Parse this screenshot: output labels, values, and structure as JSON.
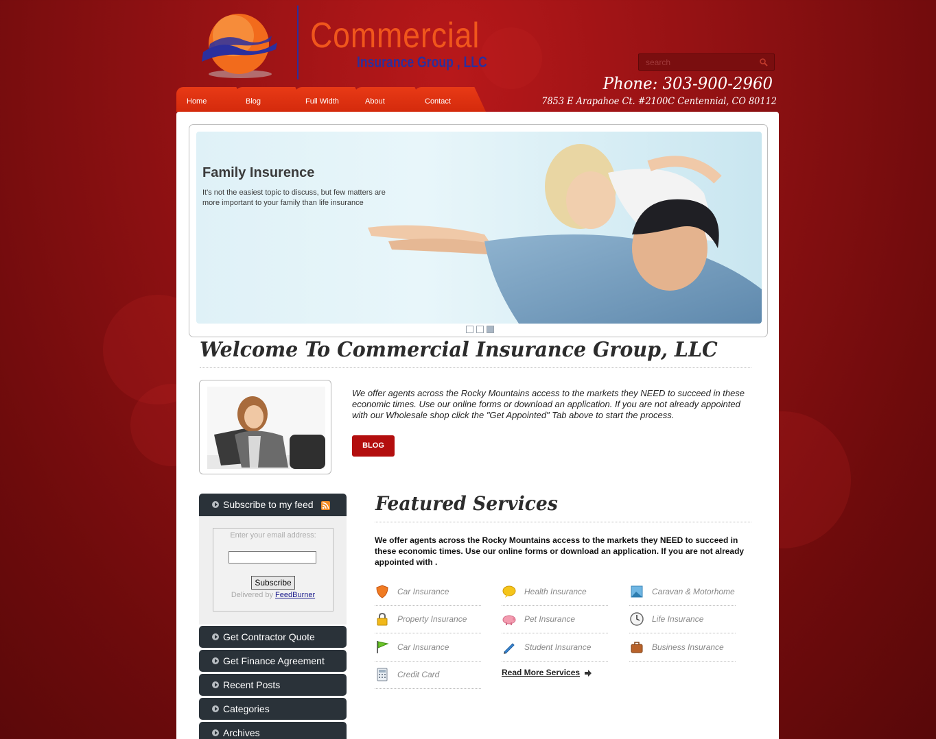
{
  "logo": {
    "title": "Commercial",
    "subtitle": "Insurance Group , LLC"
  },
  "search": {
    "placeholder": "search"
  },
  "contact": {
    "phone": "Phone: 303-900-2960",
    "address": "7853 E Arapahoe Ct. #2100C Centennial, CO 80112"
  },
  "nav": {
    "items": [
      {
        "label": "Home"
      },
      {
        "label": "Blog"
      },
      {
        "label": "Full Width"
      },
      {
        "label": "About"
      },
      {
        "label": "Contact"
      }
    ]
  },
  "slider": {
    "title": "Family Insurence",
    "text": "It's not the easiest topic to discuss, but few matters are more important to your family than life insurance",
    "slide_count": 3,
    "active_slide": 3
  },
  "welcome": {
    "title": "Welcome To Commercial Insurance Group, LLC",
    "text": "We offer agents across the Rocky Mountains access to the markets they NEED to succeed in these economic times. Use our online forms or download an application. If you are not already appointed with our Wholesale shop click the \"Get Appointed\" Tab above to start the process.",
    "button": "BLOG"
  },
  "sidebar": {
    "subscribe_title": "Subscribe to my feed",
    "email_label": "Enter your email address:",
    "subscribe_button": "Subscribe",
    "delivered_by": "Delivered by",
    "feedburner": "FeedBurner",
    "items": [
      {
        "label": "Get Contractor Quote"
      },
      {
        "label": "Get Finance Agreement"
      },
      {
        "label": "Recent Posts"
      },
      {
        "label": "Categories"
      },
      {
        "label": "Archives"
      }
    ]
  },
  "featured": {
    "title": "Featured Services",
    "text": "We offer agents across the Rocky Mountains access to the markets they NEED to succeed in these economic times. Use our online forms or download an application. If you are not already appointed with .",
    "services": [
      {
        "label": "Car Insurance",
        "icon": "shield-icon"
      },
      {
        "label": "Health Insurance",
        "icon": "speech-bubble-icon"
      },
      {
        "label": "Caravan & Motorhome",
        "icon": "picture-icon"
      },
      {
        "label": "Property Insurance",
        "icon": "padlock-icon"
      },
      {
        "label": "Pet Insurance",
        "icon": "piggy-icon"
      },
      {
        "label": "Life Insurance",
        "icon": "clock-icon"
      },
      {
        "label": "Car Insurance",
        "icon": "flag-icon"
      },
      {
        "label": "Student Insurance",
        "icon": "pen-icon"
      },
      {
        "label": "Business Insurance",
        "icon": "briefcase-icon"
      },
      {
        "label": "Credit Card",
        "icon": "calculator-icon"
      }
    ],
    "read_more": "Read More Services"
  },
  "colors": {
    "brand_red": "#b30e0e",
    "nav_orange": "#e83a16",
    "logo_orange": "#f0561c",
    "logo_blue": "#2b2f9e",
    "sidebar_dark": "#2a3239"
  }
}
